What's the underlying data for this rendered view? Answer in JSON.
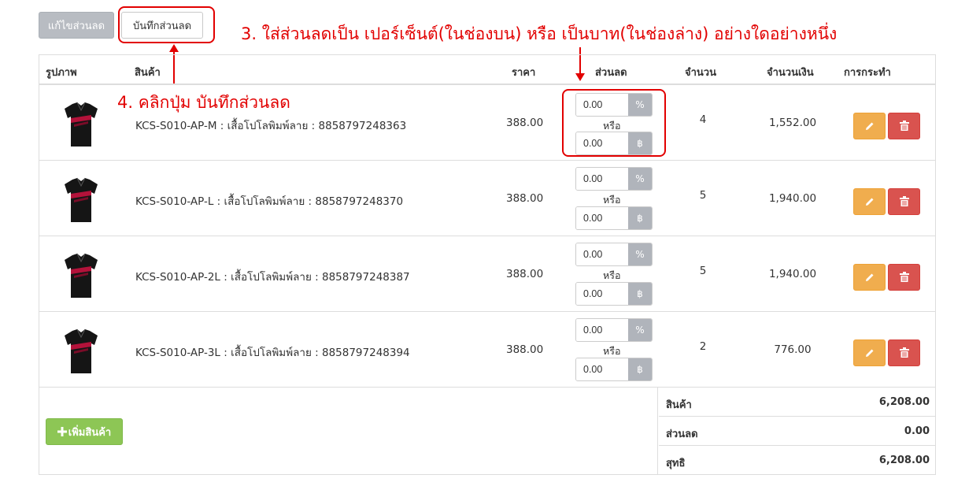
{
  "toolbar": {
    "edit_discount_label": "แก้ไขส่วนลด",
    "save_discount_label": "บันทึกส่วนลด"
  },
  "annotations": {
    "step3": "3. ใส่ส่วนลดเป็น เปอร์เซ็นต์(ในช่องบน) หรือ เป็นบาท(ในช่องล่าง) อย่างใดอย่างหนึ่ง",
    "step4": "4. คลิกปุ่ม บันทึกส่วนลด"
  },
  "table": {
    "headers": {
      "image": "รูปภาพ",
      "product": "สินค้า",
      "price": "ราคา",
      "discount": "ส่วนลด",
      "quantity": "จำนวน",
      "amount": "จำนวนเงิน",
      "actions": "การกระทำ"
    },
    "or_label": "หรือ",
    "percent_symbol": "%",
    "baht_symbol": "฿",
    "rows": [
      {
        "name": "KCS-S010-AP-M : เสื้อโปโลพิมพ์ลาย : 8858797248363",
        "price": "388.00",
        "discount_percent": "0.00",
        "discount_baht": "0.00",
        "quantity": "4",
        "amount": "1,552.00"
      },
      {
        "name": "KCS-S010-AP-L : เสื้อโปโลพิมพ์ลาย : 8858797248370",
        "price": "388.00",
        "discount_percent": "0.00",
        "discount_baht": "0.00",
        "quantity": "5",
        "amount": "1,940.00"
      },
      {
        "name": "KCS-S010-AP-2L : เสื้อโปโลพิมพ์ลาย : 8858797248387",
        "price": "388.00",
        "discount_percent": "0.00",
        "discount_baht": "0.00",
        "quantity": "5",
        "amount": "1,940.00"
      },
      {
        "name": "KCS-S010-AP-3L : เสื้อโปโลพิมพ์ลาย : 8858797248394",
        "price": "388.00",
        "discount_percent": "0.00",
        "discount_baht": "0.00",
        "quantity": "2",
        "amount": "776.00"
      }
    ]
  },
  "footer": {
    "add_product_label": "เพิ่มสินค้า",
    "summary": [
      {
        "label": "สินค้า",
        "value": "6,208.00"
      },
      {
        "label": "ส่วนลด",
        "value": "0.00"
      },
      {
        "label": "สุทธิ",
        "value": "6,208.00"
      }
    ]
  },
  "colors": {
    "annotation_red": "#e20000",
    "edit_button": "#f0ad4e",
    "delete_button": "#d9534f",
    "add_button": "#8dc655",
    "disabled_button": "#b8bcc2"
  },
  "icons": {
    "edit": "pencil-icon",
    "delete": "trash-icon",
    "add": "plus-icon",
    "product_image": "polo-shirt-image"
  }
}
